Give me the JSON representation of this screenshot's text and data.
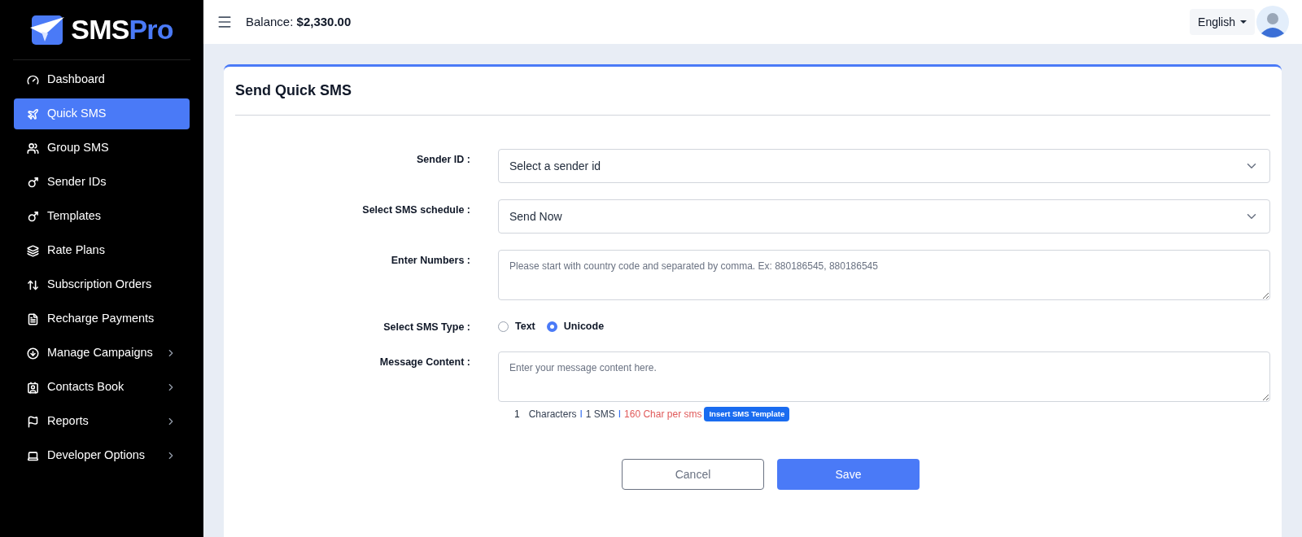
{
  "logo": {
    "part_1": "SMS",
    "part_2": "Pro"
  },
  "sidebar": {
    "items": [
      {
        "label": "Dashboard",
        "selected": false,
        "expandable": false
      },
      {
        "label": "Quick SMS",
        "selected": true,
        "expandable": false
      },
      {
        "label": "Group SMS",
        "selected": false,
        "expandable": false
      },
      {
        "label": "Sender IDs",
        "selected": false,
        "expandable": false
      },
      {
        "label": "Templates",
        "selected": false,
        "expandable": false
      },
      {
        "label": "Rate Plans",
        "selected": false,
        "expandable": false
      },
      {
        "label": "Subscription Orders",
        "selected": false,
        "expandable": false
      },
      {
        "label": "Recharge Payments",
        "selected": false,
        "expandable": false
      },
      {
        "label": "Manage Campaigns",
        "selected": false,
        "expandable": true
      },
      {
        "label": "Contacts Book",
        "selected": false,
        "expandable": true
      },
      {
        "label": "Reports",
        "selected": false,
        "expandable": true
      },
      {
        "label": "Developer Options",
        "selected": false,
        "expandable": true
      }
    ]
  },
  "header": {
    "balance_label": "Balance:",
    "balance_value": "$2,330.00",
    "language": "English"
  },
  "card": {
    "title": "Send Quick SMS",
    "fields": [
      {
        "kind": "select",
        "label": "Sender ID :",
        "value": "Select a sender id"
      },
      {
        "kind": "select",
        "label": "Select SMS schedule :",
        "value": "Send Now"
      },
      {
        "kind": "textarea",
        "label": "Enter Numbers :",
        "placeholder": "Please start with country code and separated by comma. Ex: 880186545, 880186545"
      },
      {
        "kind": "radio",
        "label": "Select SMS Type :",
        "options": [
          {
            "label": "Text",
            "selected": false
          },
          {
            "label": "Unicode",
            "selected": true
          }
        ]
      },
      {
        "kind": "textarea",
        "label": "Message Content :",
        "placeholder": "Enter your message content here."
      }
    ],
    "counter": {
      "count": "1",
      "characters": "Characters",
      "separator_1": "I",
      "sms": "1 SMS",
      "separator_2": "I",
      "limit": "160 Char per sms",
      "template_button": "Insert SMS Template"
    },
    "buttons": {
      "cancel": "Cancel",
      "save": "Save"
    }
  }
}
